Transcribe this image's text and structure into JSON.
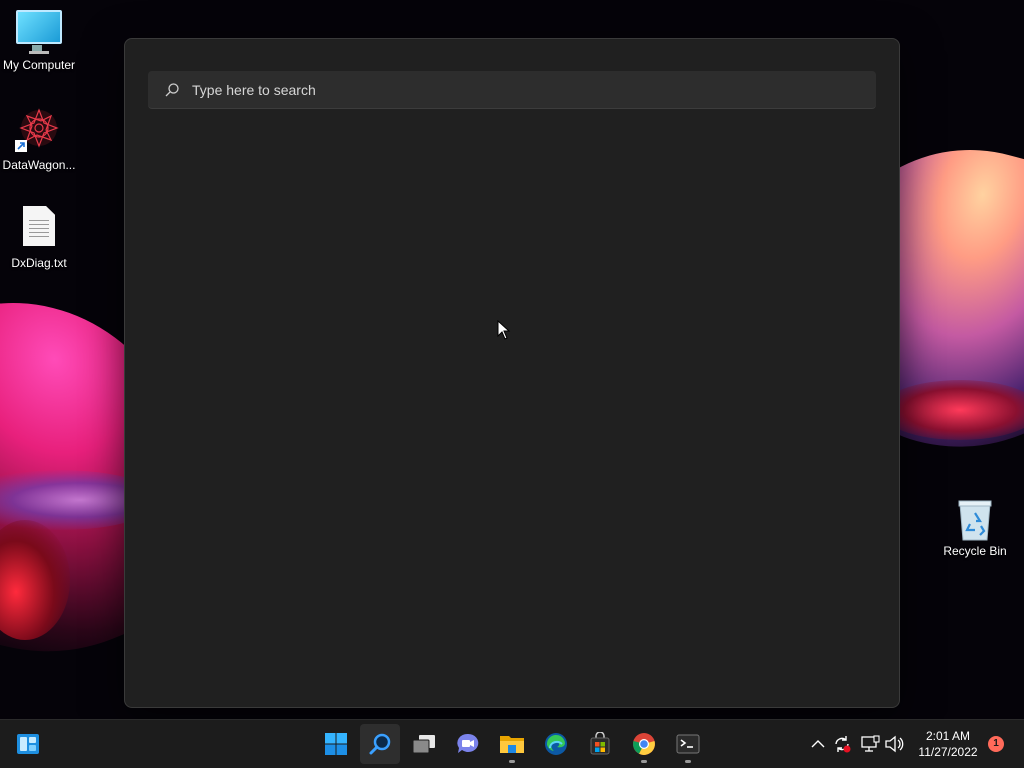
{
  "desktop": {
    "icons": [
      {
        "label": "My Computer",
        "icon": "monitor-icon"
      },
      {
        "label": "DataWagon...",
        "icon": "datawagon-icon"
      },
      {
        "label": "DxDiag.txt",
        "icon": "text-file-icon"
      },
      {
        "label": "Recycle Bin",
        "icon": "recycle-bin-icon"
      }
    ]
  },
  "search": {
    "placeholder": "Type here to search"
  },
  "taskbar": {
    "widgets": "widgets-icon",
    "pinned": [
      {
        "name": "start",
        "icon": "windows-logo-icon"
      },
      {
        "name": "search",
        "icon": "search-icon",
        "active": true
      },
      {
        "name": "task-view",
        "icon": "task-view-icon"
      },
      {
        "name": "chat",
        "icon": "teams-chat-icon"
      },
      {
        "name": "file-explorer",
        "icon": "folder-icon",
        "running": true
      },
      {
        "name": "edge",
        "icon": "edge-icon"
      },
      {
        "name": "store",
        "icon": "store-icon"
      },
      {
        "name": "chrome",
        "icon": "chrome-icon",
        "running": true
      },
      {
        "name": "terminal",
        "icon": "terminal-icon",
        "running": true
      }
    ],
    "tray": {
      "time": "2:01 AM",
      "date": "11/27/2022",
      "notification_count": "1"
    }
  },
  "colors": {
    "panel": "#202020",
    "search_box": "#2d2d2d",
    "taskbar": "#1c1c1c",
    "accent": "#0078d4",
    "badge": "#ff6a5a"
  }
}
